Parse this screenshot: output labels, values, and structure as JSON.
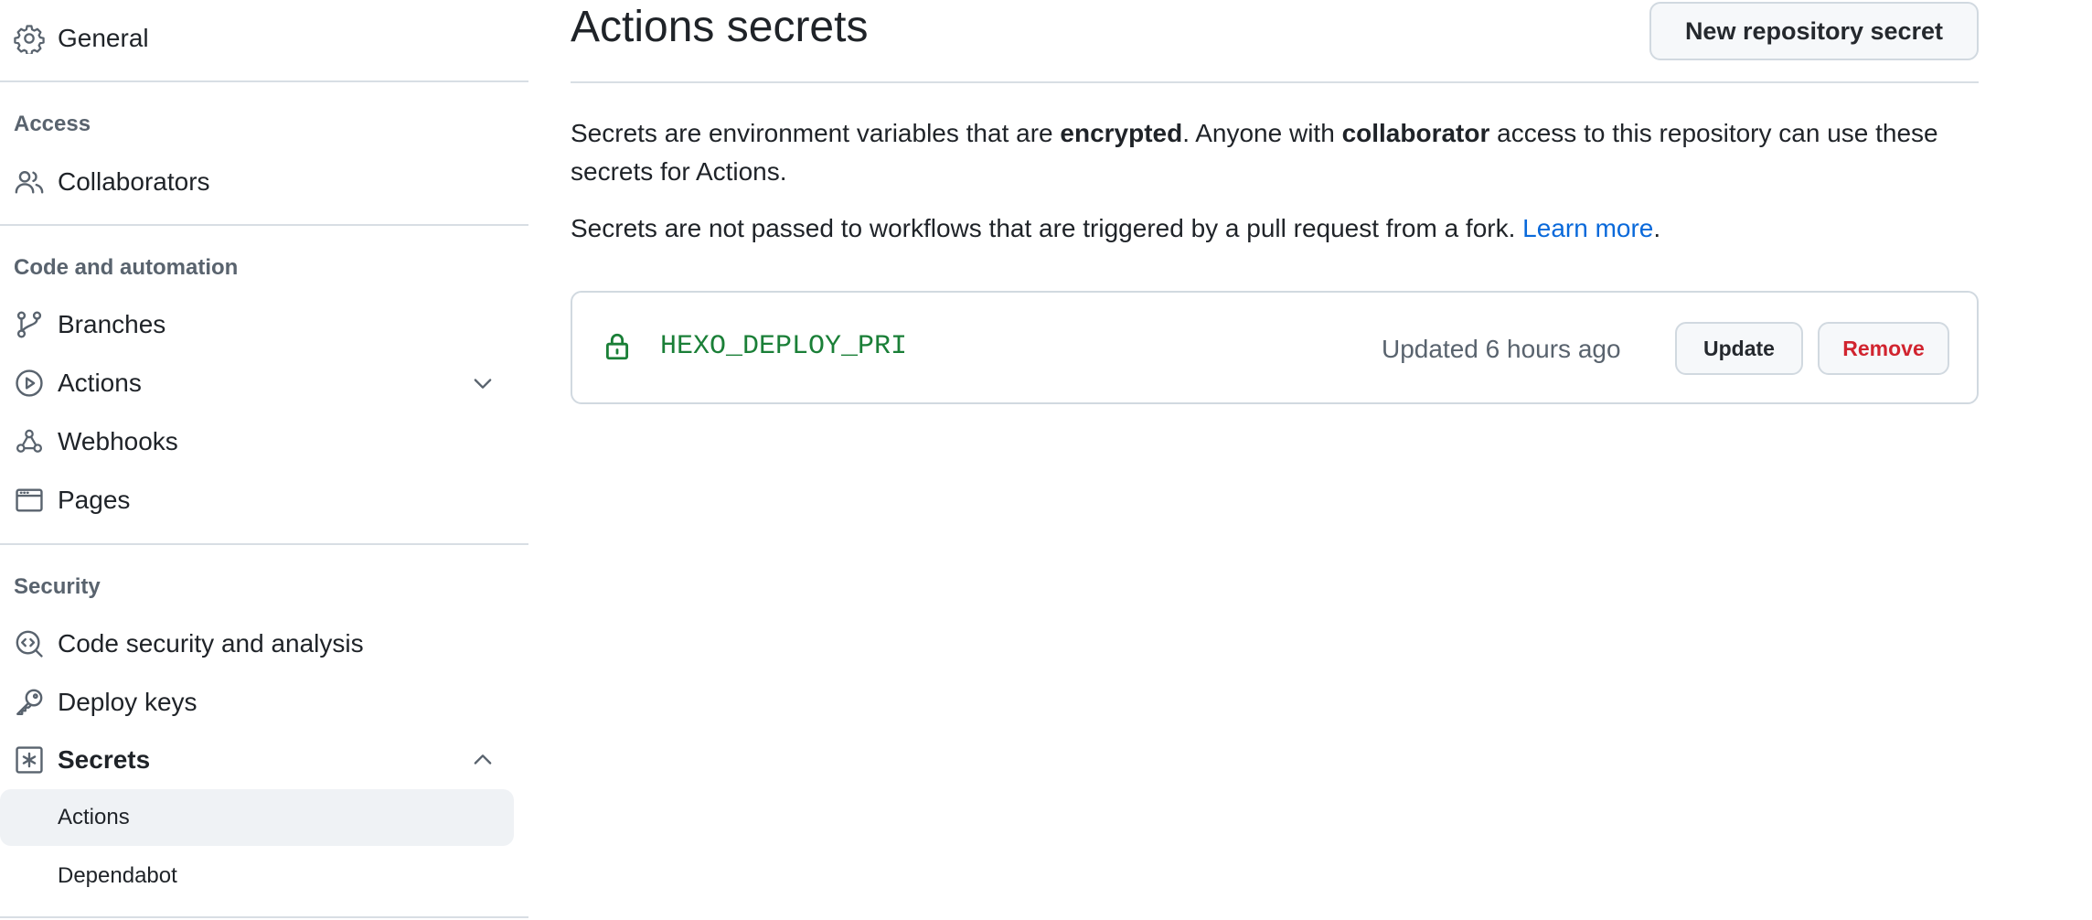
{
  "sidebar": {
    "general": "General",
    "sections": {
      "access": "Access",
      "code_automation": "Code and automation",
      "security": "Security"
    },
    "items": {
      "collaborators": "Collaborators",
      "branches": "Branches",
      "actions": "Actions",
      "webhooks": "Webhooks",
      "pages": "Pages",
      "code_security": "Code security and analysis",
      "deploy_keys": "Deploy keys",
      "secrets": "Secrets"
    },
    "secrets_sub": {
      "actions": "Actions",
      "dependabot": "Dependabot"
    },
    "active_item": "Secrets / Actions"
  },
  "main": {
    "title": "Actions secrets",
    "new_button": "New repository secret",
    "description": {
      "p1_a": "Secrets are environment variables that are ",
      "p1_b": "encrypted",
      "p1_c": ". Anyone with ",
      "p1_d": "collaborator",
      "p1_e": " access to this repository can use these secrets for Actions.",
      "p2_a": "Secrets are not passed to workflows that are triggered by a pull request from a fork. ",
      "p2_link": "Learn more",
      "p2_end": "."
    },
    "secrets": [
      {
        "name": "HEXO_DEPLOY_PRI",
        "updated": "Updated 6 hours ago",
        "update_label": "Update",
        "remove_label": "Remove"
      }
    ]
  },
  "colors": {
    "link": "#0969da",
    "secret_name": "#1a7f37",
    "danger": "#d1242f",
    "muted": "#59636e",
    "border": "#d1d9e0"
  },
  "icons": [
    "gear-icon",
    "people-icon",
    "git-branch-icon",
    "play-icon",
    "webhook-icon",
    "browser-icon",
    "codescan-icon",
    "key-icon",
    "secret-asterisk-icon",
    "chevron-down-icon",
    "chevron-up-icon",
    "lock-icon"
  ]
}
